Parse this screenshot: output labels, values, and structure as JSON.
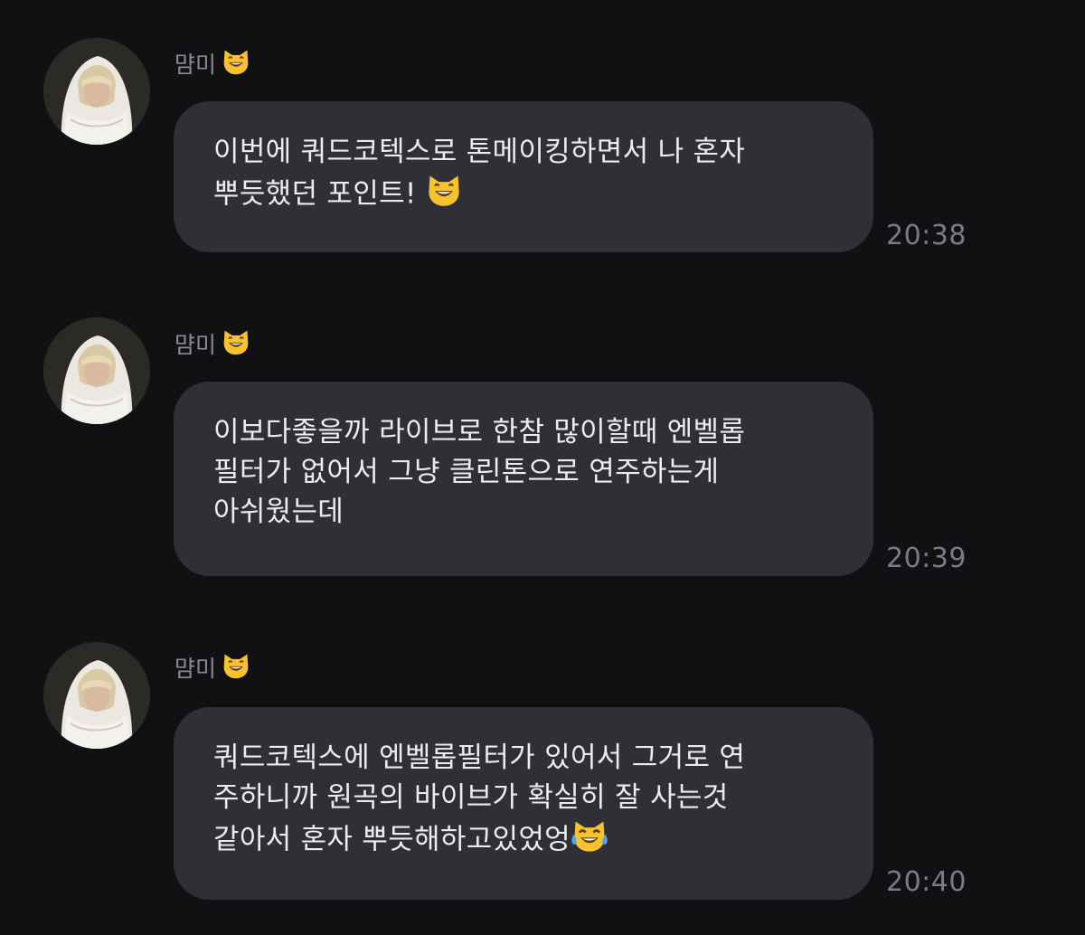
{
  "chat": {
    "messages": [
      {
        "sender": "먐미",
        "sender_emoji": "cat-grinning-icon",
        "lines": [
          "이번에 쿼드코텍스로 톤메이킹하면서 나 혼자",
          "뿌듯했던 포인트!"
        ],
        "trailing_emoji": "cat-grinning-icon",
        "time": "20:38"
      },
      {
        "sender": "먐미",
        "sender_emoji": "cat-grinning-icon",
        "lines": [
          "이보다좋을까 라이브로 한참 많이할때 엔벨롭",
          "필터가 없어서 그냥 클린톤으로 연주하는게",
          "아쉬웠는데"
        ],
        "trailing_emoji": "",
        "time": "20:39"
      },
      {
        "sender": "먐미",
        "sender_emoji": "cat-grinning-icon",
        "lines": [
          "쿼드코텍스에 엔벨롭필터가 있어서 그거로 연",
          "주하니까 원곡의 바이브가 확실히 잘 사는것",
          "같아서 혼자 뿌듯해하고있었엉"
        ],
        "trailing_emoji": "cat-tears-of-joy-icon",
        "time": "20:40"
      }
    ]
  },
  "colors": {
    "background": "#111114",
    "bubble": "#2f2f35",
    "text": "#ececec",
    "muted": "#8a8a90",
    "emoji_yellow": "#f6c22e"
  }
}
